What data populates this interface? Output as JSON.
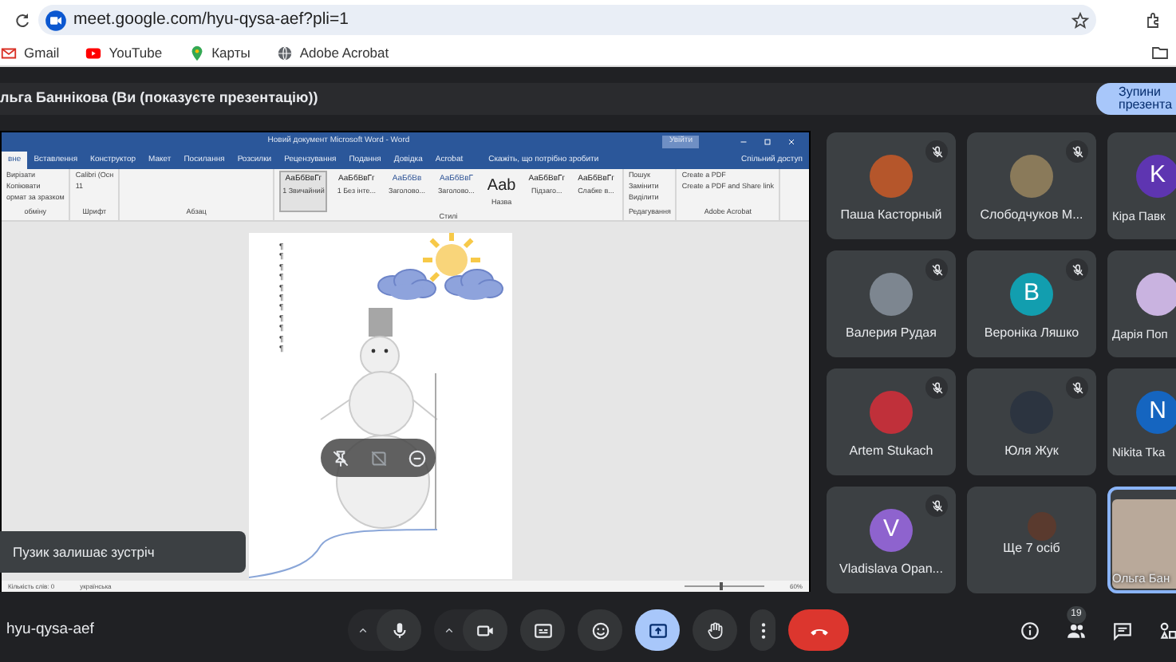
{
  "browser": {
    "url": "meet.google.com/hyu-qysa-aef?pli=1",
    "bookmarks": [
      {
        "label": "Gmail",
        "kind": "mail"
      },
      {
        "label": "YouTube",
        "kind": "youtube"
      },
      {
        "label": "Карты",
        "kind": "maps"
      },
      {
        "label": "Adobe Acrobat",
        "kind": "globe"
      }
    ]
  },
  "presenting_bar": {
    "text": "льга Баннікова (Ви (показуєте презентацію))",
    "stop_button": [
      "Зупини",
      "презента"
    ]
  },
  "shared_screen": {
    "title": "Новий документ Microsoft Word  -  Word",
    "sign_in": "Увійти",
    "tabs": [
      {
        "label": "вне",
        "selected": true
      },
      {
        "label": "Вставлення",
        "selected": false
      },
      {
        "label": "Конструктор",
        "selected": false
      },
      {
        "label": "Макет",
        "selected": false
      },
      {
        "label": "Посилання",
        "selected": false
      },
      {
        "label": "Розсилки",
        "selected": false
      },
      {
        "label": "Рецензування",
        "selected": false
      },
      {
        "label": "Подання",
        "selected": false
      },
      {
        "label": "Довідка",
        "selected": false
      },
      {
        "label": "Acrobat",
        "selected": false
      }
    ],
    "tell_me": "Скажіть, що потрібно зробити",
    "share": "Спільний доступ",
    "ribbon_groups": [
      {
        "label": "обміну",
        "items": [
          "Вирізати",
          "Копіювати",
          "ормат за зразком"
        ]
      },
      {
        "label": "Шрифт",
        "items": [
          "Calibri (Осн",
          "11"
        ]
      },
      {
        "label": "Абзац"
      },
      {
        "label": "Стилі",
        "styles": [
          {
            "preview": "АаБбВвГг",
            "name": "1 Звичайний",
            "selected": true
          },
          {
            "preview": "АаБбВвГг",
            "name": "1 Без інте...",
            "selected": false
          },
          {
            "preview": "АаБбВв",
            "name": "Заголово...",
            "selected": false
          },
          {
            "preview": "АаБбВвГ",
            "name": "Заголово...",
            "selected": false
          },
          {
            "preview": "Aab",
            "name": "Назва",
            "selected": false
          },
          {
            "preview": "АаБбВвГг",
            "name": "Підзаго...",
            "selected": false
          },
          {
            "preview": "АаБбВвГг",
            "name": "Слабке в...",
            "selected": false
          }
        ]
      },
      {
        "label": "Редагування",
        "items": [
          "Пошук",
          "Замінити",
          "Виділити"
        ]
      },
      {
        "label": "Adobe Acrobat",
        "items": [
          "Create a PDF",
          "Create a PDF and Share link"
        ]
      }
    ],
    "paragraph_marks": [
      "¶",
      "¶",
      "¶",
      "¶",
      "¶",
      "¶",
      "¶",
      "¶",
      "¶",
      "¶",
      "¶"
    ],
    "status": {
      "words": "Кількість слів: 0",
      "language": "українська",
      "zoom": "60%",
      "level": 0.45
    }
  },
  "toast": "Пузик залишає зустріч",
  "participants": [
    {
      "name": "Паша Касторный",
      "kind": "photo",
      "color": "#b5562b",
      "muted": true,
      "highlighted": false
    },
    {
      "name": "Слободчуков М...",
      "kind": "photo",
      "color": "#8a7a5a",
      "muted": true,
      "highlighted": false
    },
    {
      "name": "Кіра Павк",
      "kind": "letter",
      "letter": "K",
      "color": "#5e35b1",
      "muted": false,
      "highlighted": false
    },
    {
      "name": "Валерия Рудая",
      "kind": "photo",
      "color": "#7d8690",
      "muted": true,
      "highlighted": false
    },
    {
      "name": "Вероніка Ляшко",
      "kind": "letter",
      "letter": "B",
      "color": "#129eaf",
      "muted": true,
      "highlighted": false
    },
    {
      "name": "Дарія Поп",
      "kind": "photo",
      "color": "#c9b3e0",
      "muted": false,
      "highlighted": false
    },
    {
      "name": "Artem Stukach",
      "kind": "photo",
      "color": "#c0303a",
      "muted": true,
      "highlighted": false
    },
    {
      "name": "Юля Жук",
      "kind": "photo",
      "color": "#2c3440",
      "muted": true,
      "highlighted": false
    },
    {
      "name": "Nikita Tka",
      "kind": "letter",
      "letter": "N",
      "color": "#1565c0",
      "muted": false,
      "highlighted": false
    },
    {
      "name": "Vladislava Opan...",
      "kind": "letter",
      "letter": "V",
      "color": "#8e63ce",
      "muted": true,
      "highlighted": false
    },
    {
      "name": "Ще 7 осіб",
      "kind": "more",
      "color": "#5a3a2e",
      "muted": false,
      "highlighted": false
    },
    {
      "name": "Ольга Бан",
      "kind": "video",
      "color": "#b9a99a",
      "muted": false,
      "highlighted": true
    }
  ],
  "meeting_code": "hyu-qysa-aef",
  "controls": [
    {
      "kind": "mic",
      "caret": true,
      "on": false
    },
    {
      "kind": "camera",
      "caret": true,
      "on": false
    },
    {
      "kind": "captions",
      "caret": false,
      "on": false
    },
    {
      "kind": "emoji",
      "caret": false,
      "on": false
    },
    {
      "kind": "present",
      "caret": false,
      "on": true
    },
    {
      "kind": "hand",
      "caret": false,
      "on": false
    },
    {
      "kind": "more",
      "caret": false,
      "on": false
    },
    {
      "kind": "end",
      "caret": false,
      "on": false
    }
  ],
  "side_controls": [
    {
      "kind": "info"
    },
    {
      "kind": "people",
      "badge": "19"
    },
    {
      "kind": "chat"
    },
    {
      "kind": "activities"
    }
  ]
}
